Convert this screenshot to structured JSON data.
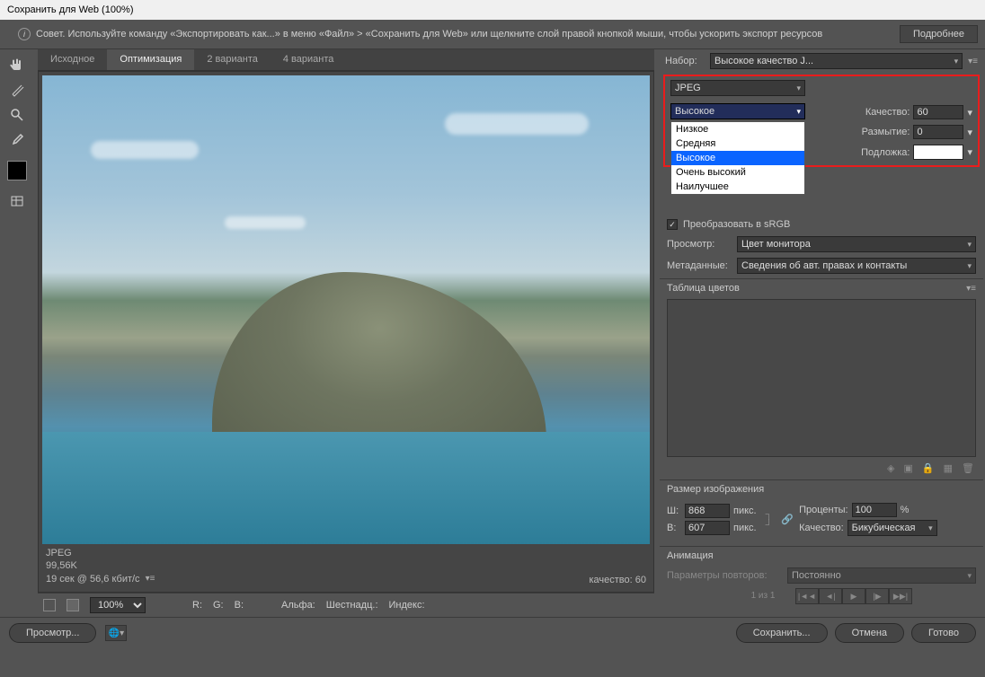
{
  "title": "Сохранить для Web (100%)",
  "tip": {
    "text": "Совет. Используйте команду «Экспортировать как...» в меню «Файл» > «Сохранить для Web» или щелкните слой правой кнопкой мыши, чтобы ускорить экспорт ресурсов",
    "more": "Подробнее"
  },
  "tabs": [
    "Исходное",
    "Оптимизация",
    "2 варианта",
    "4 варианта"
  ],
  "active_tab": 1,
  "preview": {
    "format": "JPEG",
    "size": "99,56K",
    "time": "19 сек @ 56,6 кбит/с",
    "quality_label": "качество: 60"
  },
  "zoom": {
    "value": "100%",
    "r": "R:",
    "g": "G:",
    "b": "B:",
    "alpha": "Альфа:",
    "hex": "Шестнадц.:",
    "index": "Индекс:"
  },
  "preset": {
    "label": "Набор:",
    "value": "Высокое качество J..."
  },
  "format": {
    "value": "JPEG"
  },
  "quality_sel": {
    "value": "Высокое",
    "options": [
      "Низкое",
      "Средняя",
      "Высокое",
      "Очень высокий",
      "Наилучшее"
    ],
    "selected_index": 2
  },
  "quality_field": {
    "label": "Качество:",
    "value": "60"
  },
  "blur_field": {
    "label": "Размытие:",
    "value": "0"
  },
  "matte_field": {
    "label": "Подложка:"
  },
  "srgb": {
    "label": "Преобразовать в sRGB",
    "checked": true
  },
  "view": {
    "label": "Просмотр:",
    "value": "Цвет монитора"
  },
  "meta": {
    "label": "Метаданные:",
    "value": "Сведения об авт. правах и контакты"
  },
  "color_table": {
    "title": "Таблица цветов"
  },
  "image_size": {
    "title": "Размер изображения",
    "w_label": "Ш:",
    "w": "868",
    "w_unit": "пикс.",
    "h_label": "В:",
    "h": "607",
    "h_unit": "пикс.",
    "percent_label": "Проценты:",
    "percent": "100",
    "percent_unit": "%",
    "quality_label": "Качество:",
    "quality_val": "Бикубическая"
  },
  "animation": {
    "title": "Анимация",
    "loop_label": "Параметры повторов:",
    "loop_val": "Постоянно",
    "page": "1 из 1"
  },
  "bottom": {
    "preview": "Просмотр...",
    "save": "Сохранить...",
    "cancel": "Отмена",
    "done": "Готово"
  }
}
